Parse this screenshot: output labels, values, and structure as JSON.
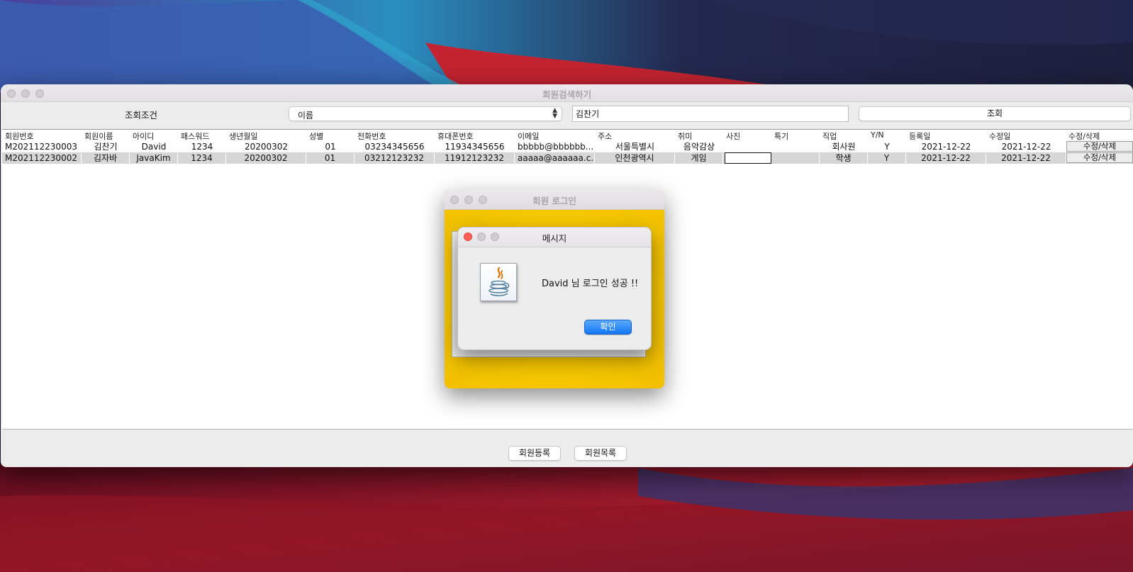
{
  "main_window": {
    "title": "회원검색하기",
    "search_label": "조회조건",
    "search_field_select": "이름",
    "search_input_value": "김찬기",
    "query_button": "조회",
    "table": {
      "columns": [
        "회원번호",
        "회원이름",
        "아이디",
        "패스워드",
        "생년월일",
        "성별",
        "전화번호",
        "휴대폰번호",
        "이메일",
        "주소",
        "취미",
        "사진",
        "특기",
        "직업",
        "Y/N",
        "등록일",
        "수정일",
        "수정/삭제"
      ],
      "rows": [
        {
          "id": "M202112230003",
          "name": "김찬기",
          "user_id": "David",
          "password": "1234",
          "birth": "20200302",
          "gender": "01",
          "phone": "03234345656",
          "mobile": "11934345656",
          "email": "bbbbb@bbbbbb...",
          "address": "서울특별시",
          "hobby": "음악감상",
          "photo": "",
          "skill": "",
          "job": "회사원",
          "yn": "Y",
          "registered": "2021-12-22",
          "modified": "2021-12-22",
          "action": "수정/삭제"
        },
        {
          "id": "M202112230002",
          "name": "김자바",
          "user_id": "JavaKim",
          "password": "1234",
          "birth": "20200302",
          "gender": "01",
          "phone": "03212123232",
          "mobile": "11912123232",
          "email": "aaaaa@aaaaaa.c...",
          "address": "인천광역시",
          "hobby": "게임",
          "photo": "",
          "skill": "",
          "job": "학생",
          "yn": "Y",
          "registered": "2021-12-22",
          "modified": "2021-12-22",
          "action": "수정/삭제"
        }
      ]
    },
    "register_button": "회원등록",
    "list_button": "회원목록"
  },
  "login_window": {
    "title": "회원 로그인"
  },
  "message_dialog": {
    "title": "메시지",
    "message": "David 님 로그인 성공  !!",
    "ok_button": "확인"
  },
  "colors": {
    "close_red": "#fe5f57",
    "login_background": "#f8c800",
    "ok_button_blue": "#1476f2",
    "selected_row": "#d6d6d6"
  }
}
